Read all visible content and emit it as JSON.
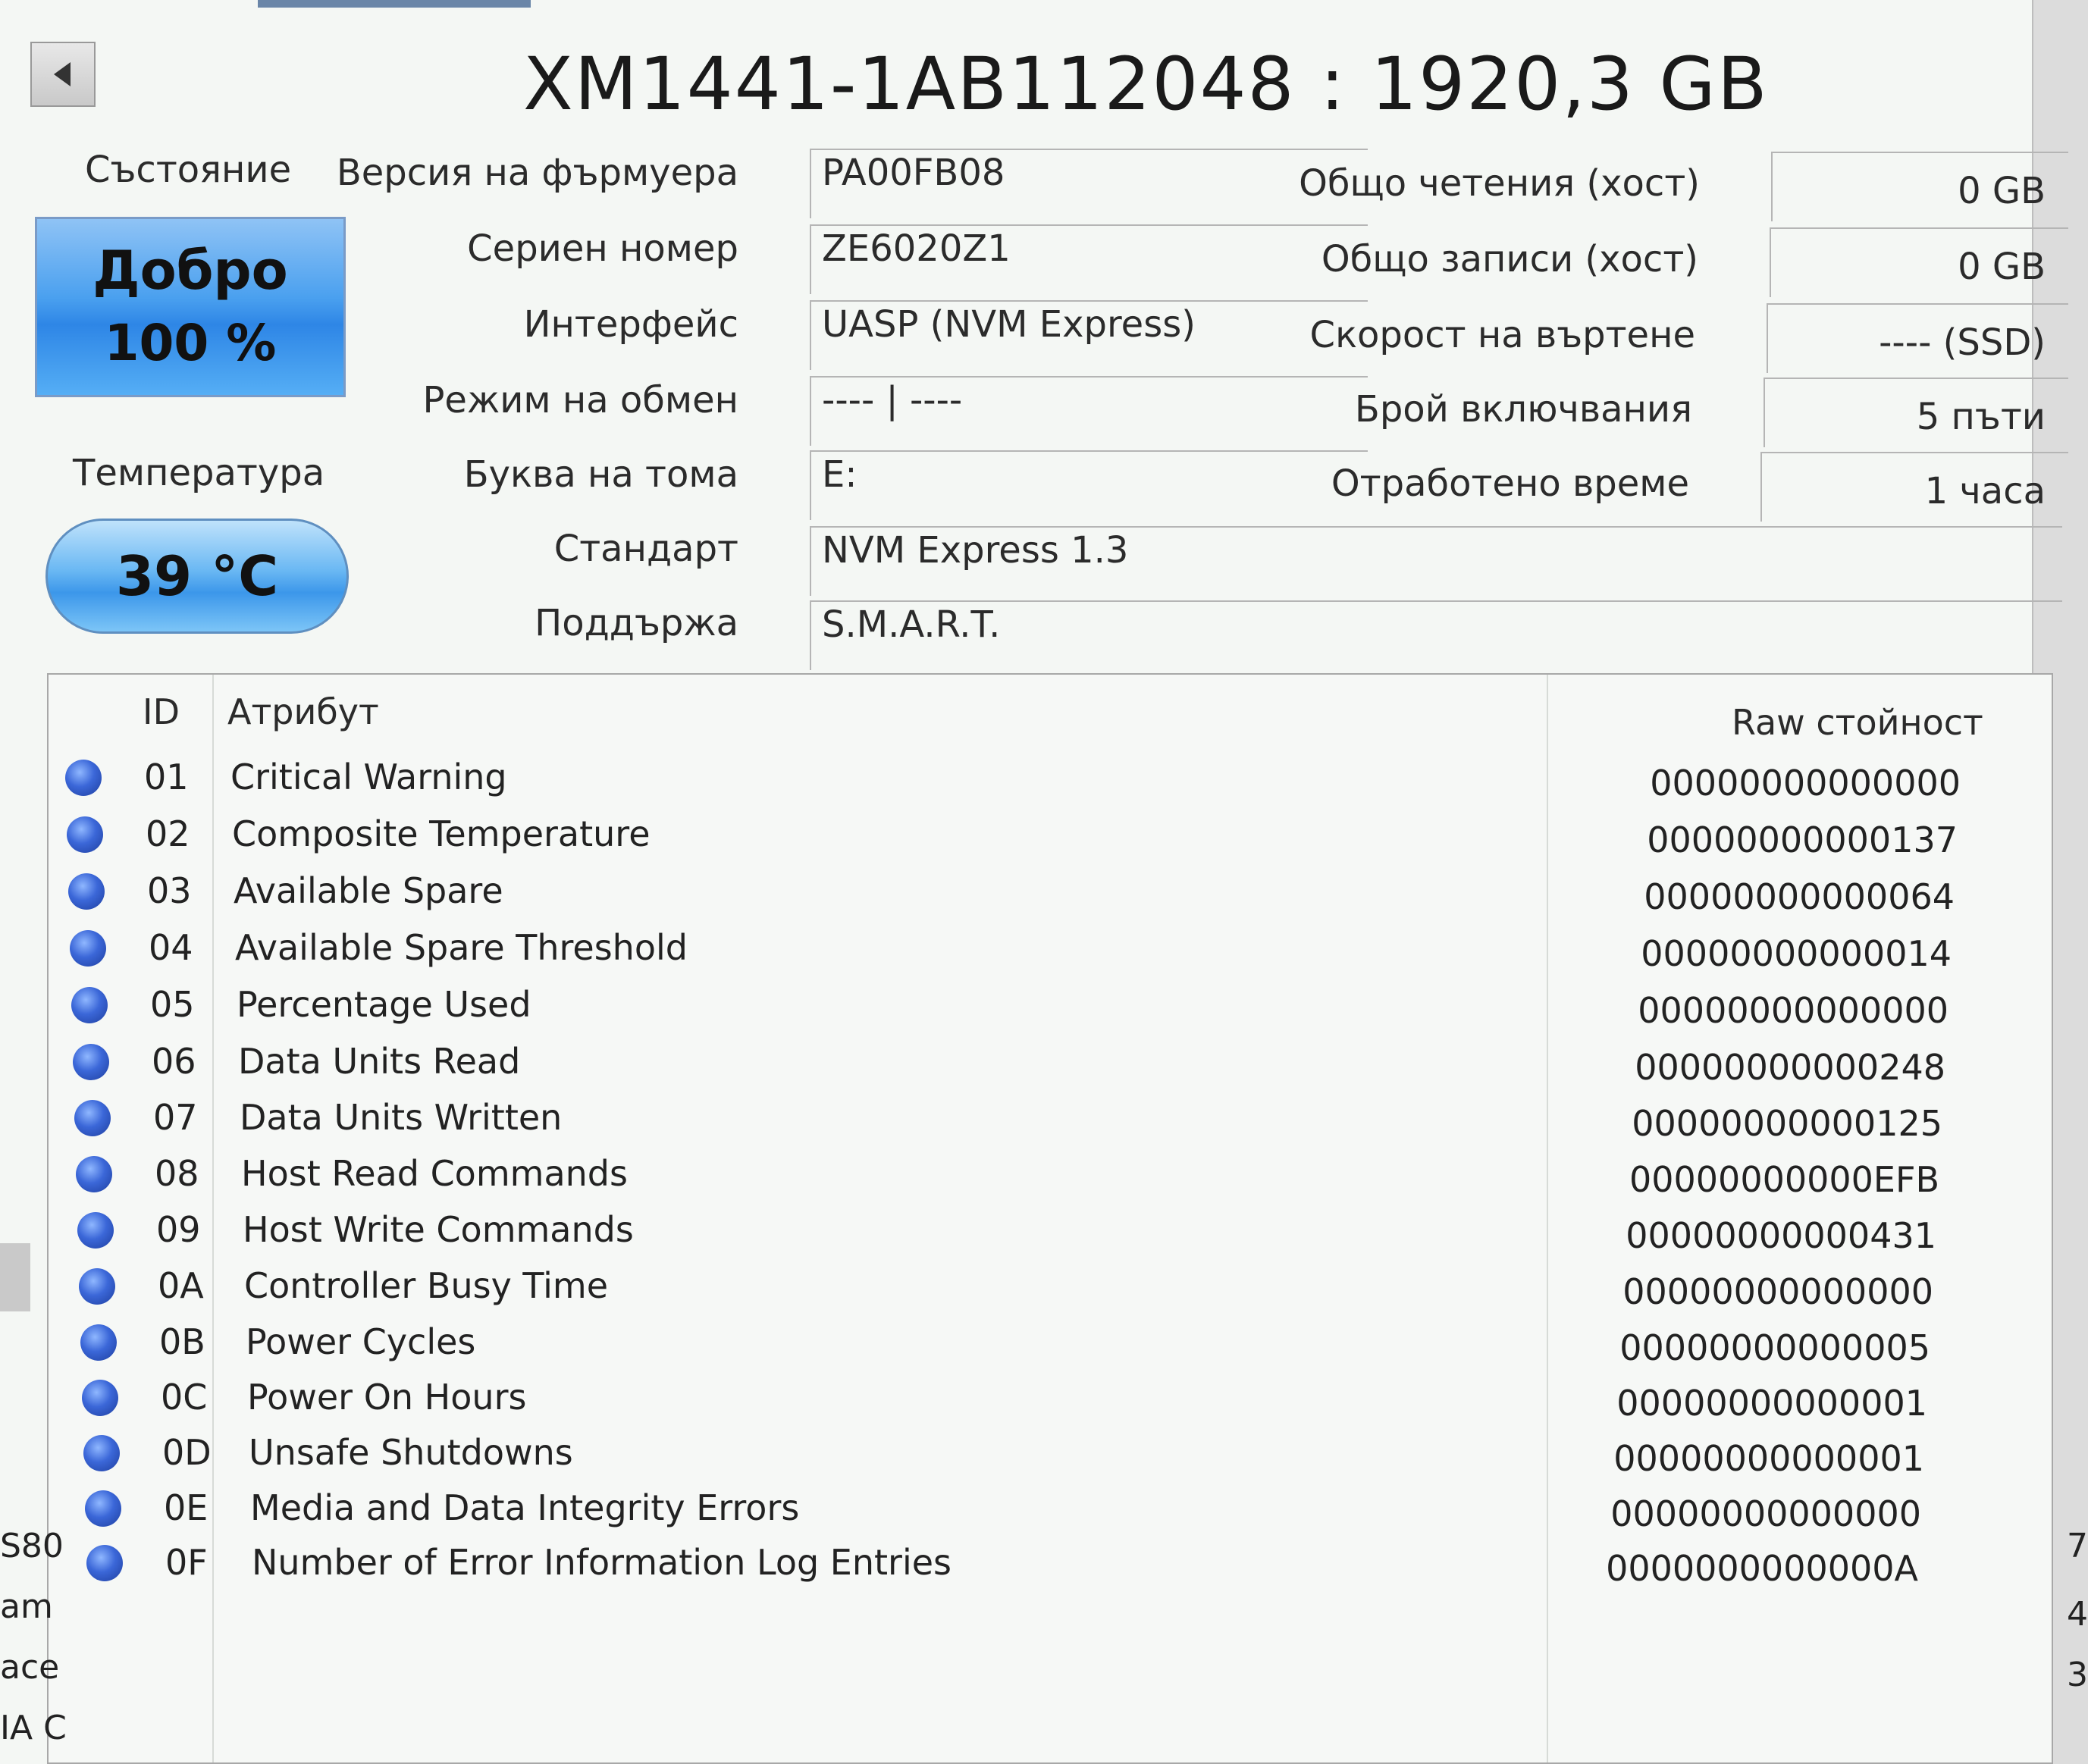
{
  "title": "XM1441-1AB112048 : 1920,3 GB",
  "status": {
    "label": "Състояние",
    "value": "Добро",
    "percent": "100 %"
  },
  "temperature": {
    "label": "Температура",
    "value": "39 °C"
  },
  "fields": [
    {
      "label": "Версия на фърмуера",
      "value": "PA00FB08"
    },
    {
      "label": "Сериен номер",
      "value": "ZE6020Z1"
    },
    {
      "label": "Интерфейс",
      "value": "UASP (NVM Express)"
    },
    {
      "label": "Режим на обмен",
      "value": "---- | ----"
    },
    {
      "label": "Буква на тома",
      "value": "E:"
    },
    {
      "label": "Стандарт",
      "value": "NVM Express 1.3"
    },
    {
      "label": "Поддържа",
      "value": "S.M.A.R.T."
    }
  ],
  "right_fields": [
    {
      "label": "Общо четения (хост)",
      "value": "0 GB"
    },
    {
      "label": "Общо записи (хост)",
      "value": "0 GB"
    },
    {
      "label": "Скорост на въртене",
      "value": "---- (SSD)"
    },
    {
      "label": "Брой включвания",
      "value": "5 пъти"
    },
    {
      "label": "Отработено време",
      "value": "1 часа"
    }
  ],
  "table": {
    "headers": {
      "id": "ID",
      "attribute": "Атрибут",
      "raw": "Raw стойност"
    },
    "rows": [
      {
        "id": "01",
        "name": "Critical Warning",
        "raw": "00000000000000"
      },
      {
        "id": "02",
        "name": "Composite Temperature",
        "raw": "00000000000137"
      },
      {
        "id": "03",
        "name": "Available Spare",
        "raw": "00000000000064"
      },
      {
        "id": "04",
        "name": "Available Spare Threshold",
        "raw": "00000000000014"
      },
      {
        "id": "05",
        "name": "Percentage Used",
        "raw": "00000000000000"
      },
      {
        "id": "06",
        "name": "Data Units Read",
        "raw": "00000000000248"
      },
      {
        "id": "07",
        "name": "Data Units Written",
        "raw": "00000000000125"
      },
      {
        "id": "08",
        "name": "Host Read Commands",
        "raw": "00000000000EFB"
      },
      {
        "id": "09",
        "name": "Host Write Commands",
        "raw": "00000000000431"
      },
      {
        "id": "0A",
        "name": "Controller Busy Time",
        "raw": "00000000000000"
      },
      {
        "id": "0B",
        "name": "Power Cycles",
        "raw": "00000000000005"
      },
      {
        "id": "0C",
        "name": "Power On Hours",
        "raw": "00000000000001"
      },
      {
        "id": "0D",
        "name": "Unsafe Shutdowns",
        "raw": "00000000000001"
      },
      {
        "id": "0E",
        "name": "Media and Data Integrity Errors",
        "raw": "00000000000000"
      },
      {
        "id": "0F",
        "name": "Number of Error Information Log Entries",
        "raw": "0000000000000A"
      }
    ]
  },
  "background_fragments": [
    "S80",
    "am",
    "ace",
    "IA C",
    "7",
    "4",
    "3"
  ],
  "icons": {
    "back": "back-arrow-icon",
    "status_dot": "status-dot-icon"
  },
  "colors": {
    "status_blue": "#3a92ea",
    "dot_blue": "#3b67d8"
  }
}
